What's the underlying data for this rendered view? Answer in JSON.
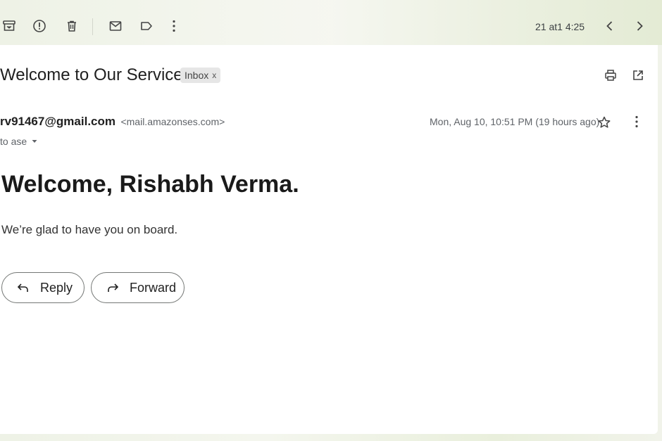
{
  "toolbar": {
    "icons": [
      "archive-icon",
      "report-spam-icon",
      "delete-icon",
      "mark-unread-icon",
      "label-icon",
      "more-vert-icon"
    ],
    "counter": "21 at1 4:25",
    "nav_icons": [
      "chevron-left-icon",
      "chevron-right-icon"
    ]
  },
  "email": {
    "subject": "Welcome to Our Service",
    "label": "Inbox",
    "label_remove": "x",
    "sender_name": "rv91467@gmail.com",
    "sender_email": "<mail.amazonses.com>",
    "recipient": "to ase",
    "date": "Mon, Aug 10, 10:51 PM (19 hours ago)",
    "header_icons": [
      "print-icon",
      "open-in-new-window-icon",
      "star-icon",
      "more-vert-icon"
    ]
  },
  "body": {
    "heading": "Welcome, Rishabh Verma.",
    "text": "We’re glad to have you on board."
  },
  "actions": {
    "reply": "Reply",
    "forward": "Forward"
  }
}
